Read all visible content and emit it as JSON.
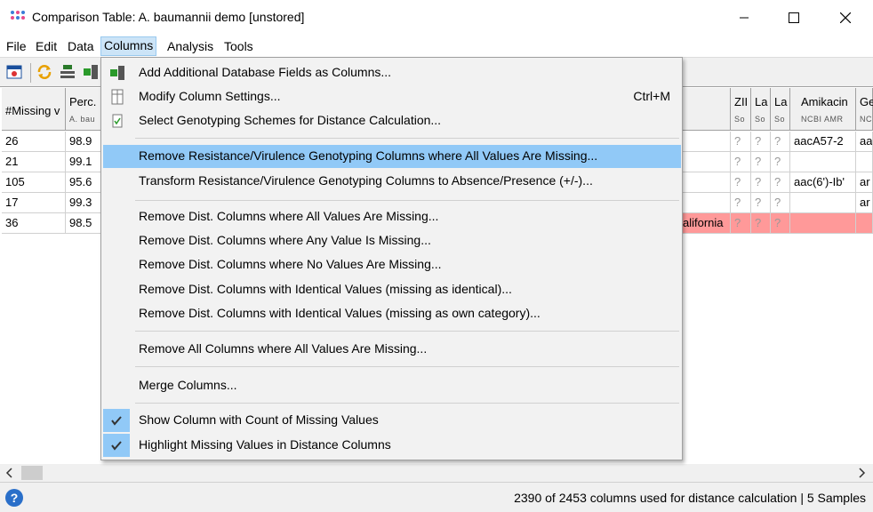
{
  "window": {
    "title": "Comparison Table: A. baumannii demo [unstored]"
  },
  "menubar": [
    "File",
    "Edit",
    "Data",
    "Columns",
    "Analysis",
    "Tools"
  ],
  "table": {
    "headers": [
      {
        "title": "#Missing v",
        "sub": ""
      },
      {
        "title": "Perc.",
        "sub": "A. bau"
      },
      {
        "title": "ZII",
        "sub": "So"
      },
      {
        "title": "La",
        "sub": "So"
      },
      {
        "title": "La",
        "sub": "So"
      },
      {
        "title": "Amikacin",
        "sub": "NCBI AMR"
      },
      {
        "title": "Ge",
        "sub": "NC"
      }
    ],
    "rows": [
      {
        "missing": "26",
        "perc": "98.9",
        "text": "",
        "q1": "?",
        "q2": "?",
        "q3": "?",
        "amikacin": "aacA57-2",
        "ge": "aa"
      },
      {
        "missing": "21",
        "perc": "99.1",
        "text": "",
        "q1": "?",
        "q2": "?",
        "q3": "?",
        "amikacin": "",
        "ge": ""
      },
      {
        "missing": "105",
        "perc": "95.6",
        "text": "",
        "q1": "?",
        "q2": "?",
        "q3": "?",
        "amikacin": "aac(6')-Ib'",
        "ge": "ar"
      },
      {
        "missing": "17",
        "perc": "99.3",
        "text": "",
        "q1": "?",
        "q2": "?",
        "q3": "?",
        "amikacin": "",
        "ge": "ar"
      },
      {
        "missing": "36",
        "perc": "98.5",
        "text": "alifornia",
        "q1": "?",
        "q2": "?",
        "q3": "?",
        "amikacin": "",
        "ge": ""
      }
    ]
  },
  "dropdown": {
    "items": [
      {
        "label": "Add Additional Database Fields as Columns...",
        "shortcut": ""
      },
      {
        "label": "Modify Column Settings...",
        "shortcut": "Ctrl+M"
      },
      {
        "label": "Select Genotyping Schemes for Distance Calculation...",
        "shortcut": ""
      },
      {
        "label": "Remove Resistance/Virulence Genotyping Columns where All Values Are Missing...",
        "shortcut": ""
      },
      {
        "label": "Transform Resistance/Virulence Genotyping Columns to Absence/Presence (+/-)...",
        "shortcut": ""
      },
      {
        "label": "Remove Dist. Columns where All Values Are Missing...",
        "shortcut": ""
      },
      {
        "label": "Remove Dist. Columns where Any Value Is Missing...",
        "shortcut": ""
      },
      {
        "label": "Remove Dist. Columns where No Values Are Missing...",
        "shortcut": ""
      },
      {
        "label": "Remove Dist. Columns with Identical Values (missing as identical)...",
        "shortcut": ""
      },
      {
        "label": "Remove Dist. Columns with Identical Values (missing as own category)...",
        "shortcut": ""
      },
      {
        "label": "Remove All Columns where All Values Are Missing...",
        "shortcut": ""
      },
      {
        "label": "Merge Columns...",
        "shortcut": ""
      },
      {
        "label": "Show Column with Count of Missing Values",
        "shortcut": "",
        "checked": true
      },
      {
        "label": "Highlight Missing Values in Distance Columns",
        "shortcut": "",
        "checked": true
      }
    ],
    "highlighted_index": 3
  },
  "status": {
    "text": "2390 of 2453 columns used for distance calculation  |  5 Samples"
  },
  "colors": {
    "menu_highlight": "#91c9f7",
    "missing_row": "#ff9999",
    "menu_active": "#cce4f7"
  }
}
